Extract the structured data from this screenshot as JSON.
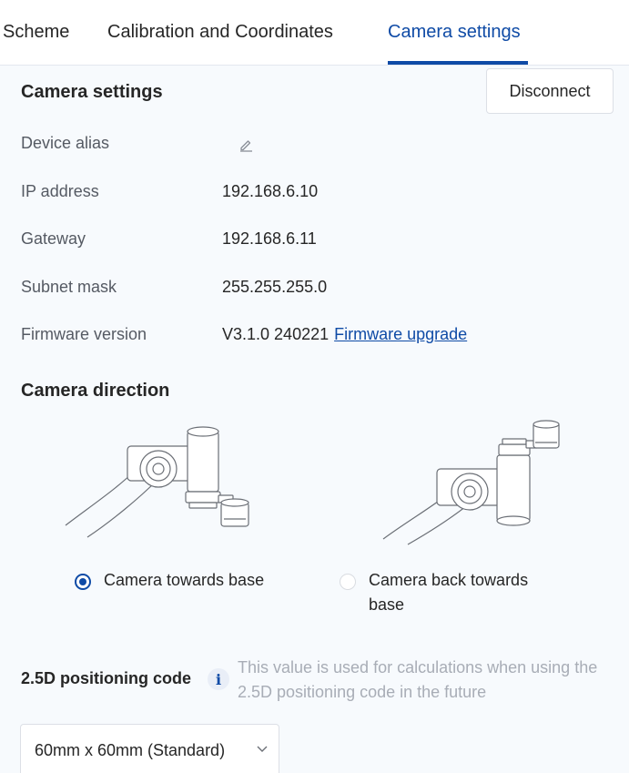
{
  "tabs": [
    {
      "label": "Scheme",
      "active": false
    },
    {
      "label": "Calibration and Coordinates",
      "active": false
    },
    {
      "label": "Camera settings",
      "active": true
    }
  ],
  "camera_settings": {
    "title": "Camera settings",
    "disconnect_label": "Disconnect",
    "fields": {
      "device_alias": {
        "label": "Device alias",
        "value": ""
      },
      "ip_address": {
        "label": "IP address",
        "value": "192.168.6.10"
      },
      "gateway": {
        "label": "Gateway",
        "value": "192.168.6.11"
      },
      "subnet_mask": {
        "label": "Subnet mask",
        "value": "255.255.255.0"
      },
      "firmware_version": {
        "label": "Firmware version",
        "value": "V3.1.0 240221",
        "upgrade_link": "Firmware upgrade"
      }
    }
  },
  "camera_direction": {
    "title": "Camera direction",
    "options": [
      {
        "label": "Camera towards base",
        "checked": true
      },
      {
        "label": "Camera back towards base",
        "checked": false
      }
    ]
  },
  "positioning": {
    "label": "2.5D positioning code",
    "info_icon": "i",
    "hint": "This value is used for calculations when using the 2.5D positioning code in the future",
    "selected": "60mm x 60mm (Standard)"
  },
  "colors": {
    "accent": "#0f4ba6",
    "background": "#f7fafd",
    "hint_text": "#a8adb6"
  }
}
